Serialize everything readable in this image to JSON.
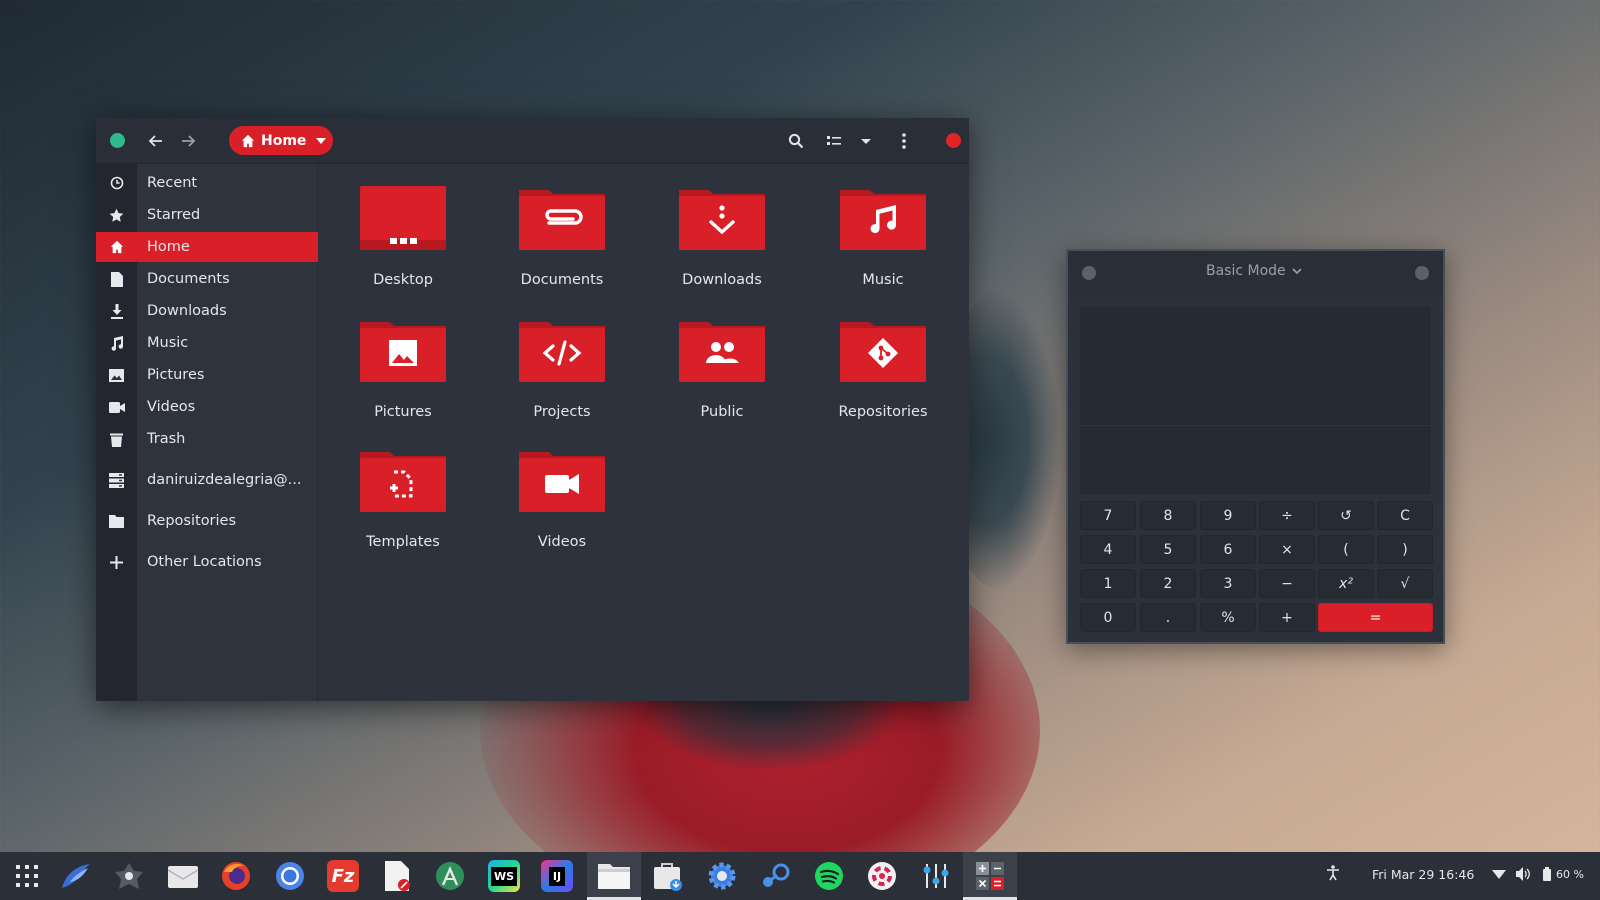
{
  "file_manager": {
    "path_button": {
      "label": "Home"
    },
    "sidebar": {
      "items": [
        {
          "id": "recent",
          "label": "Recent",
          "icon": "clock-icon"
        },
        {
          "id": "starred",
          "label": "Starred",
          "icon": "star-icon"
        },
        {
          "id": "home",
          "label": "Home",
          "icon": "home-icon",
          "active": true
        },
        {
          "id": "documents",
          "label": "Documents",
          "icon": "document-icon"
        },
        {
          "id": "downloads",
          "label": "Downloads",
          "icon": "download-icon"
        },
        {
          "id": "music",
          "label": "Music",
          "icon": "music-note-icon"
        },
        {
          "id": "pictures",
          "label": "Pictures",
          "icon": "image-icon"
        },
        {
          "id": "videos",
          "label": "Videos",
          "icon": "video-camera-icon"
        },
        {
          "id": "trash",
          "label": "Trash",
          "icon": "trash-icon"
        },
        {
          "id": "network",
          "label": "daniruizdealegria@...",
          "icon": "network-server-icon"
        },
        {
          "id": "repositories",
          "label": "Repositories",
          "icon": "folder-icon"
        },
        {
          "id": "other",
          "label": "Other Locations",
          "icon": "plus-icon"
        }
      ]
    },
    "folders": [
      {
        "label": "Desktop",
        "icon": "desktop-folder-icon"
      },
      {
        "label": "Documents",
        "icon": "paperclip-icon"
      },
      {
        "label": "Downloads",
        "icon": "download-icon"
      },
      {
        "label": "Music",
        "icon": "music-note-icon"
      },
      {
        "label": "Pictures",
        "icon": "image-icon"
      },
      {
        "label": "Projects",
        "icon": "code-icon"
      },
      {
        "label": "Public",
        "icon": "people-icon"
      },
      {
        "label": "Repositories",
        "icon": "git-icon"
      },
      {
        "label": "Templates",
        "icon": "template-icon"
      },
      {
        "label": "Videos",
        "icon": "video-camera-icon"
      }
    ]
  },
  "calculator": {
    "mode_label": "Basic Mode",
    "buttons": [
      [
        "7",
        "8",
        "9",
        "÷",
        "↺",
        "C"
      ],
      [
        "4",
        "5",
        "6",
        "×",
        "(",
        ")"
      ],
      [
        "1",
        "2",
        "3",
        "−",
        "x²",
        "√"
      ],
      [
        "0",
        ".",
        "%",
        "+",
        "="
      ]
    ]
  },
  "taskbar": {
    "clock": "Fri Mar 29  16:46",
    "battery": "60 %",
    "apps": [
      "app-grid-icon",
      "budgie-icon",
      "eye-of-gnome-icon",
      "mail-icon",
      "firefox-icon",
      "chromium-icon",
      "filezilla-icon",
      "text-editor-icon",
      "android-studio-icon",
      "webstorm-icon",
      "intellij-icon",
      "files-icon",
      "software-center-icon",
      "settings-icon",
      "steam-icon",
      "spotify-icon",
      "ubuntu-icon",
      "mixer-icon",
      "calculator-icon"
    ]
  },
  "colors": {
    "accent": "#d91f27",
    "window_bg": "#2e323d",
    "sidebar_bg": "#2f333d"
  }
}
